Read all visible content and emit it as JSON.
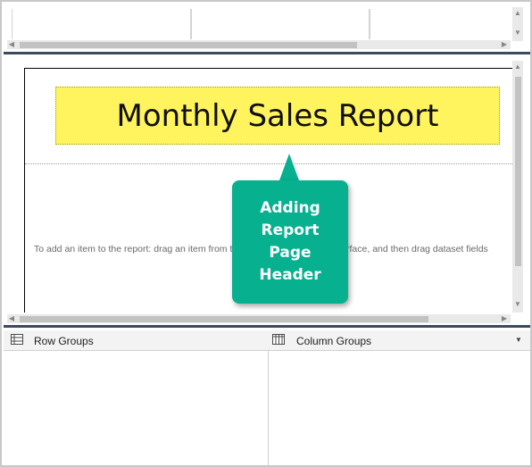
{
  "report": {
    "title": "Monthly Sales Report",
    "hint": "To add an item to the report: drag an item from the Toolbox to the design surface, and then drag dataset fields"
  },
  "callout": {
    "lines": [
      "Adding",
      "Report",
      "Page",
      "Header"
    ]
  },
  "grouping": {
    "row_label": "Row Groups",
    "column_label": "Column Groups"
  },
  "icons": {
    "row_groups": "row-groups-icon",
    "column_groups": "column-groups-icon",
    "dropdown": "chevron-down-icon"
  },
  "colors": {
    "title_fill": "#fff45e",
    "callout_fill": "#07b08f",
    "divider": "#3c4a5f"
  }
}
